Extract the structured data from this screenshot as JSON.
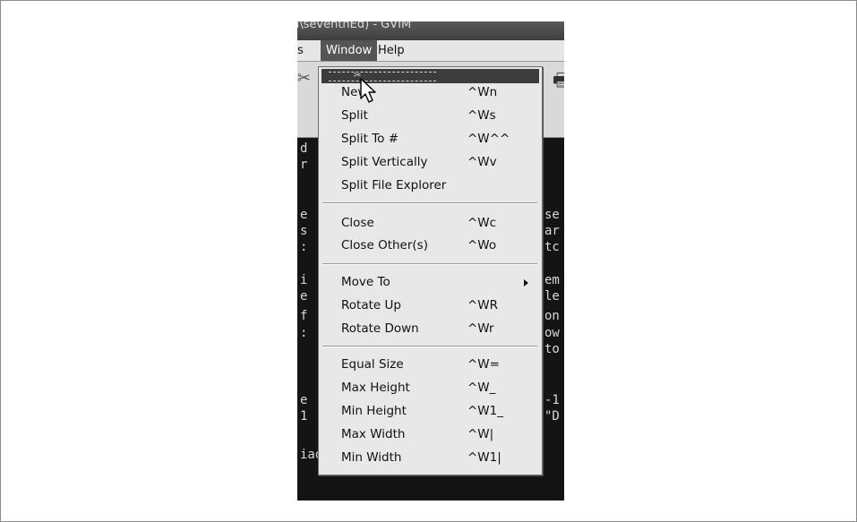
{
  "window": {
    "title": "n\\seventhEd) - GVIM"
  },
  "menubar": {
    "items": [
      "s",
      "Window",
      "Help"
    ],
    "active": "Window"
  },
  "terminal_lines": [
    {
      "left": "d",
      "right": ""
    },
    {
      "left": "r",
      "right": ""
    },
    {
      "left": "e",
      "right": "se"
    },
    {
      "left": "s",
      "right": "ar"
    },
    {
      "left": ":",
      "right": "tc"
    },
    {
      "left": "i",
      "right": "em"
    },
    {
      "left": "e",
      "right": "le"
    },
    {
      "left": "f",
      "right": "on"
    },
    {
      "left": ":",
      "right": "ow"
    },
    {
      "left": "",
      "right": "to"
    },
    {
      "left": "e",
      "right": "-1"
    },
    {
      "left": "1",
      "right": "\"D"
    },
    {
      "left": "iaobject>",
      "right": ""
    }
  ],
  "window_menu": {
    "items": [
      {
        "label": "New",
        "shortcut": "^Wn"
      },
      {
        "label": "Split",
        "shortcut": "^Ws"
      },
      {
        "label": "Split To #",
        "shortcut": "^W^^"
      },
      {
        "label": "Split Vertically",
        "shortcut": "^Wv"
      },
      {
        "label": "Split File Explorer",
        "shortcut": ""
      },
      {
        "label": "Close",
        "shortcut": "^Wc"
      },
      {
        "label": "Close Other(s)",
        "shortcut": "^Wo"
      },
      {
        "label": "Move To",
        "shortcut": ""
      },
      {
        "label": "Rotate Up",
        "shortcut": "^WR"
      },
      {
        "label": "Rotate Down",
        "shortcut": "^Wr"
      },
      {
        "label": "Equal Size",
        "shortcut": "^W="
      },
      {
        "label": "Max Height",
        "shortcut": "^W_"
      },
      {
        "label": "Min Height",
        "shortcut": "^W1_"
      },
      {
        "label": "Max Width",
        "shortcut": "^W|"
      },
      {
        "label": "Min Width",
        "shortcut": "^W1|"
      }
    ]
  },
  "icons": {
    "tearoff": "scissors-icon",
    "submenu": "triangle-right-icon",
    "pointer": "mouse-cursor-icon"
  }
}
